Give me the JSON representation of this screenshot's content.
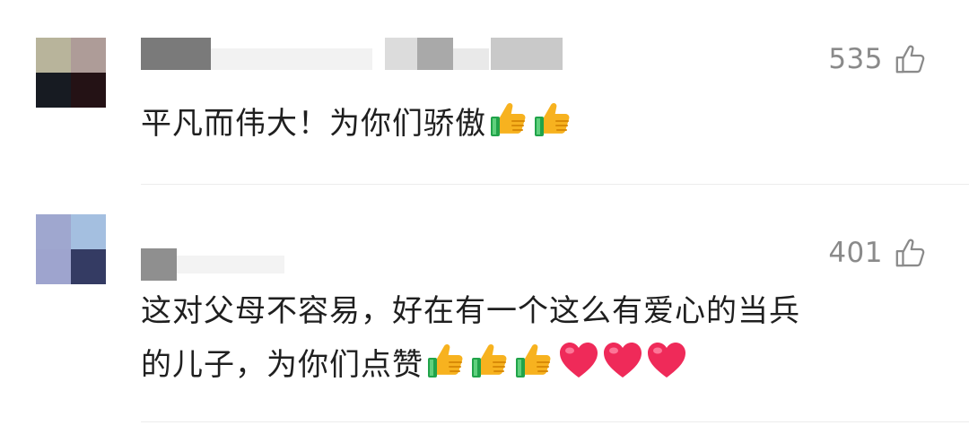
{
  "comments": [
    {
      "likes": "535",
      "text": "平凡而伟大！为你们骄傲",
      "emojis": [
        "thumbs-up",
        "thumbs-up"
      ]
    },
    {
      "likes": "401",
      "text_line1": "这对父母不容易，好在有一个这么有爱心的当兵",
      "text_line2": "的儿子，为你们点赞",
      "emojis": [
        "thumbs-up",
        "thumbs-up",
        "thumbs-up",
        "heart",
        "heart",
        "heart"
      ]
    }
  ],
  "icons": {
    "like": "thumb-up-outline-icon",
    "thumbs_up_emoji": "thumbs-up-emoji",
    "heart_emoji": "heart-emoji"
  },
  "colors": {
    "text": "#1f1f1f",
    "meta": "#8a8a8a",
    "thumb_yellow": "#f7b21f",
    "thumb_green": "#21a34a",
    "heart": "#ef2a59"
  }
}
